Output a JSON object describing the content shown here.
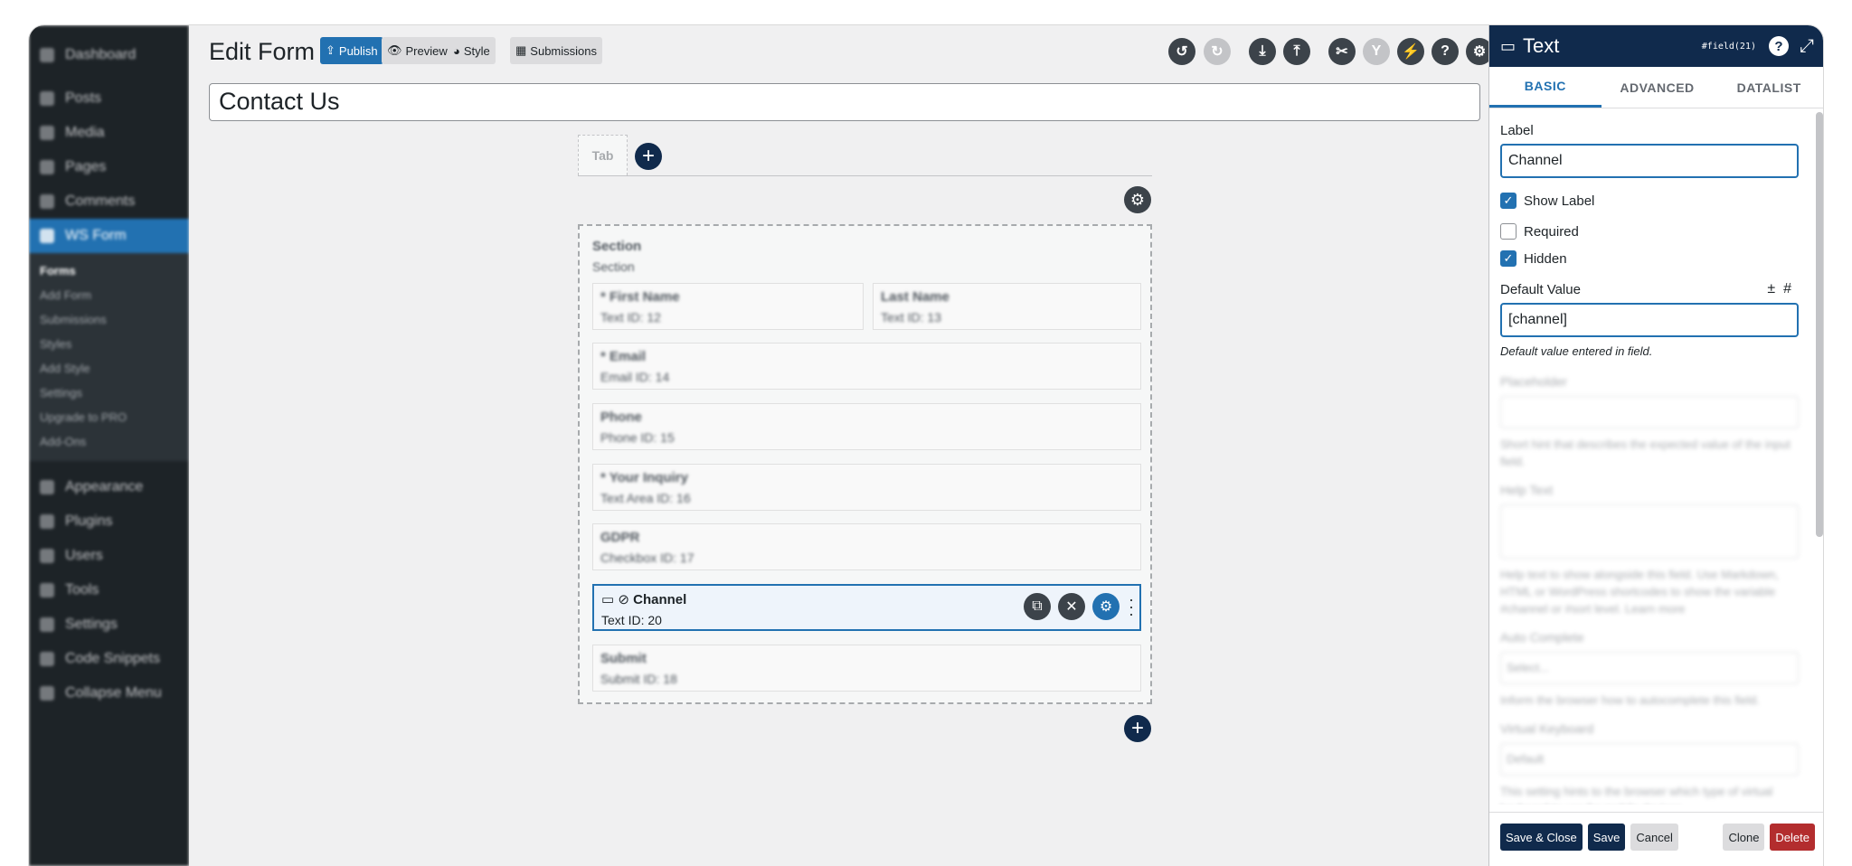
{
  "sidebar": {
    "items_top": [
      "Dashboard",
      "Posts",
      "Media",
      "Pages",
      "Comments",
      "WS Form"
    ],
    "submenu": [
      "Forms",
      "Add Form",
      "Submissions",
      "Styles",
      "Add Style",
      "Settings",
      "Upgrade to PRO",
      "Add-Ons"
    ],
    "items_bottom": [
      "Appearance",
      "Plugins",
      "Users",
      "Tools",
      "Settings",
      "Code Snippets",
      "Collapse Menu"
    ]
  },
  "header": {
    "title": "Edit Form",
    "publish": "Publish",
    "preview": "Preview",
    "style": "Style",
    "submissions": "Submissions"
  },
  "form_name": "Contact Us",
  "tab_label": "Tab",
  "section": {
    "title": "Section",
    "subtitle": "Section",
    "fields": [
      {
        "label": "* First Name",
        "meta": "Text  ID: 12"
      },
      {
        "label": "Last Name",
        "meta": "Text  ID: 13"
      },
      {
        "label": "* Email",
        "meta": "Email  ID: 14"
      },
      {
        "label": "Phone",
        "meta": "Phone  ID: 15"
      },
      {
        "label": "* Your Inquiry",
        "meta": "Text Area  ID: 16"
      },
      {
        "label": "GDPR",
        "meta": "Checkbox  ID: 17"
      },
      {
        "label": "Channel",
        "meta": "Text  ID: 20"
      },
      {
        "label": "Submit",
        "meta": "Submit  ID: 18"
      }
    ]
  },
  "panel": {
    "title": "Text",
    "field_id": "#field(21)",
    "tabs": [
      "BASIC",
      "ADVANCED",
      "DATALIST"
    ],
    "label_caption": "Label",
    "label_value": "Channel",
    "show_label": "Show Label",
    "required": "Required",
    "hidden": "Hidden",
    "default_caption": "Default Value",
    "default_value": "[channel]",
    "default_hint": "Default value entered in field.",
    "blurred": {
      "placeholder": "Placeholder",
      "placeholder_help": "Short hint that describes the expected value of the input field.",
      "help_text": "Help Text",
      "help_help": "Help text to show alongside this field. Use Markdown, HTML or WordPress shortcodes to show the variable #channel or #sort level. Learn more",
      "auto_complete": "Auto Complete",
      "auto_complete_value": "Select...",
      "auto_complete_help": "Inform the browser how to autocomplete this field.",
      "virtual_keyboard": "Virtual Keyboard",
      "virtual_keyboard_value": "Default",
      "virtual_keyboard_help": "This setting hints to the browser which type of virtual keyboard to use for mobile devices."
    },
    "footer": {
      "save_close": "Save & Close",
      "save": "Save",
      "cancel": "Cancel",
      "clone": "Clone",
      "delete": "Delete"
    }
  },
  "colors": {
    "primary": "#2271b1",
    "navy": "#102a4c",
    "danger": "#b32d2e",
    "sidebar": "#1d2327"
  }
}
